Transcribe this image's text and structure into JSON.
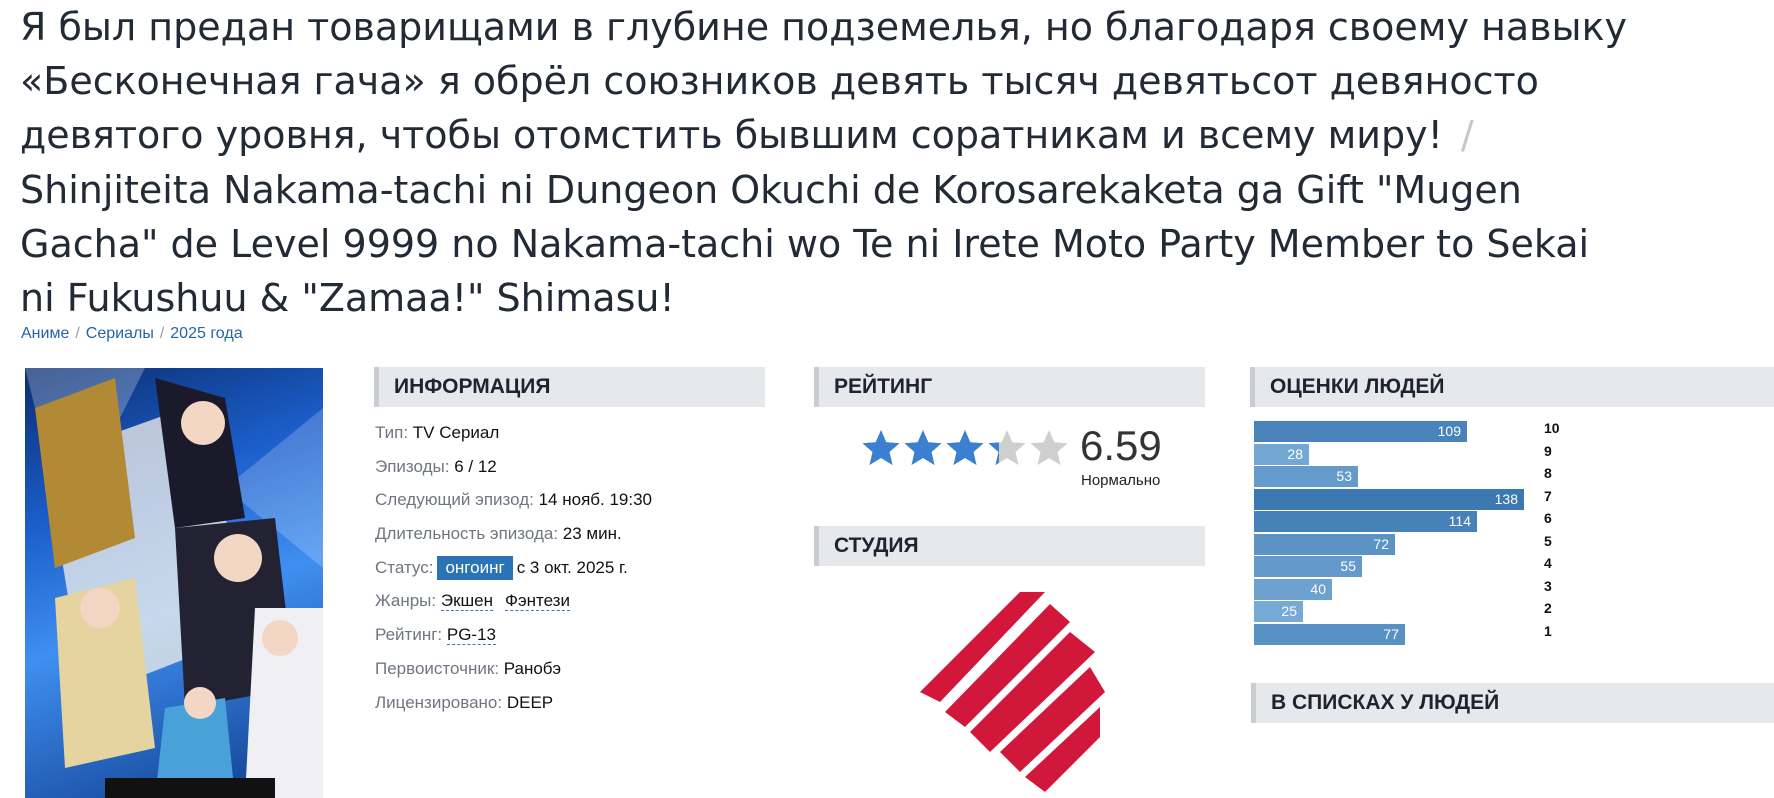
{
  "page": {
    "title_ru_1": "Я был предан товарищами в глубине подземелья, но благодаря своему навыку",
    "title_ru_2": "«Бесконечная гача» я обрёл союзников девять тысяч девятьсот девяносто",
    "title_ru_3": "девятого уровня, чтобы отомстить бывшим соратникам и всему миру!",
    "title_sep": "/",
    "title_jp_1": "Shinjiteita Nakama-tachi ni Dungeon Okuchi de Korosarekaketa ga Gift \"Mugen",
    "title_jp_2": "Gacha\" de Level 9999 no Nakama-tachi wo Te ni Irete Moto Party Member to Sekai",
    "title_jp_3": "ni Fukushuu & \"Zamaa!\" Shimasu!"
  },
  "breadcrumbs": [
    "Аниме",
    "Сериалы",
    "2025 года"
  ],
  "info": {
    "heading": "ИНФОРМАЦИЯ",
    "type_label": "Тип:",
    "type_value": "TV Сериал",
    "episodes_label": "Эпизоды:",
    "episodes_value": "6 / 12",
    "next_label": "Следующий эпизод:",
    "next_value": "14 нояб. 19:30",
    "duration_label": "Длительность эпизода:",
    "duration_value": "23 мин.",
    "status_label": "Статус:",
    "status_badge": "онгоинг",
    "status_value": "с 3 окт. 2025 г.",
    "genres_label": "Жанры:",
    "genre_1": "Экшен",
    "genre_2": "Фэнтези",
    "rating_label": "Рейтинг:",
    "rating_value": "PG-13",
    "source_label": "Первоисточник:",
    "source_value": "Ранобэ",
    "licensed_label": "Лицензировано:",
    "licensed_value": "DEEP"
  },
  "rating": {
    "heading": "РЕЙТИНГ",
    "score": "6.59",
    "label": "Нормально",
    "stars_filled": 3.3,
    "star_color": "#3a7fd0",
    "star_empty_color": "#cfcfcf"
  },
  "studio": {
    "heading": "СТУДИЯ",
    "logo_color": "#d2183a"
  },
  "votes": {
    "heading": "ОЦЕНКИ ЛЮДЕЙ",
    "rows": [
      {
        "score": "10",
        "count": 109
      },
      {
        "score": "9",
        "count": 28
      },
      {
        "score": "8",
        "count": 53
      },
      {
        "score": "7",
        "count": 138
      },
      {
        "score": "6",
        "count": 114
      },
      {
        "score": "5",
        "count": 72
      },
      {
        "score": "4",
        "count": 55
      },
      {
        "score": "3",
        "count": 40
      },
      {
        "score": "2",
        "count": 25
      },
      {
        "score": "1",
        "count": 77
      }
    ]
  },
  "lists": {
    "heading": "В СПИСКАХ У ЛЮДЕЙ"
  }
}
